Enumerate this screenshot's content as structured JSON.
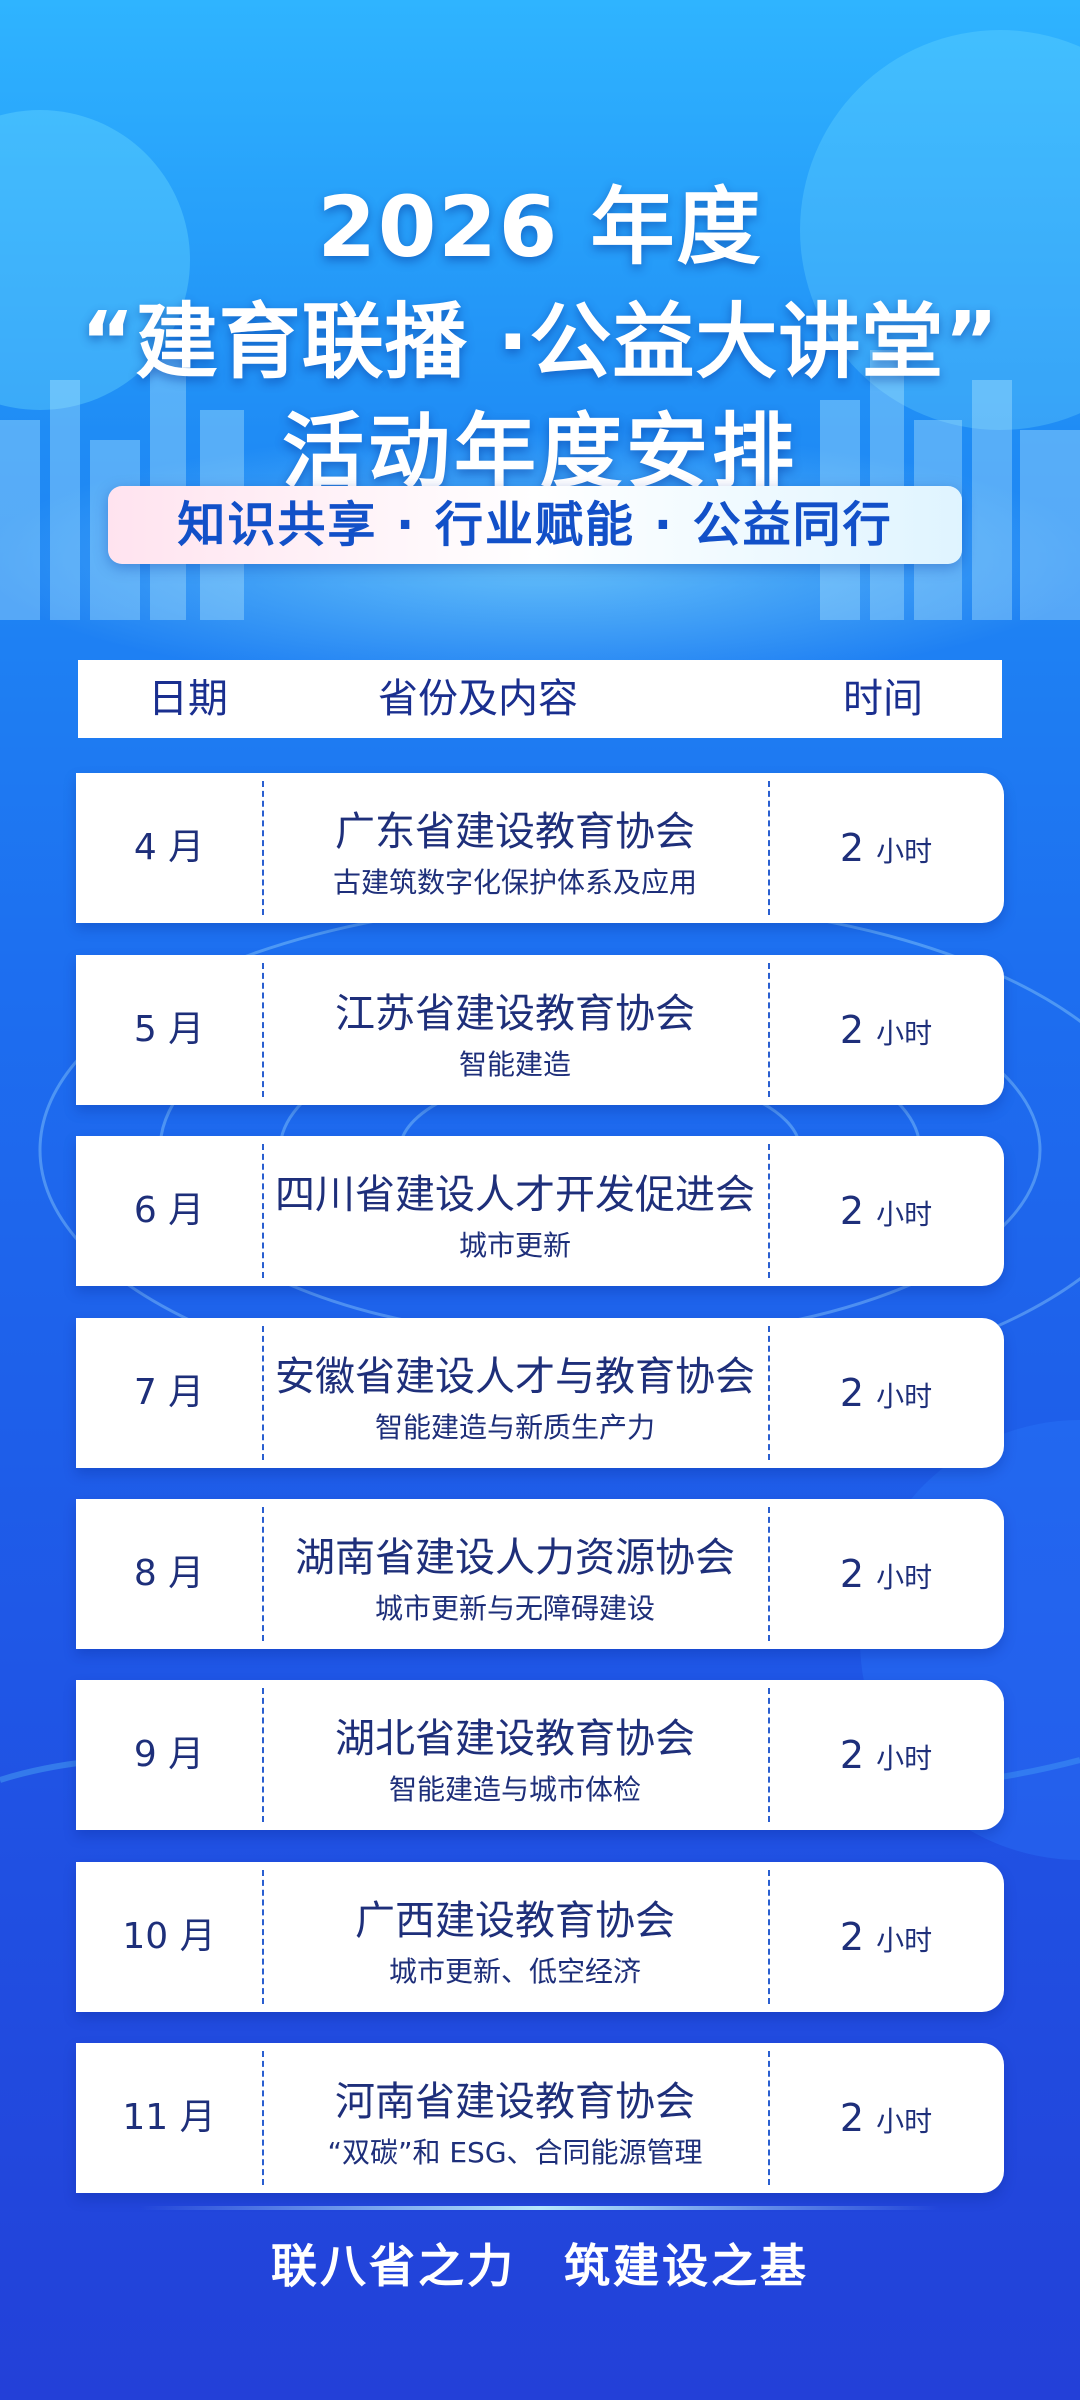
{
  "title": {
    "line1": "2026 年度",
    "line2": "“建育联播 ·公益大讲堂”",
    "line3": "活动年度安排"
  },
  "slogan": "知识共享 · 行业赋能 · 公益同行",
  "table": {
    "headers": {
      "date": "日期",
      "content": "省份及内容",
      "time": "时间"
    },
    "rows": [
      {
        "month": "4 月",
        "org": "广东省建设教育协会",
        "topic": "古建筑数字化保护体系及应用",
        "hours": "2",
        "unit": "小时"
      },
      {
        "month": "5 月",
        "org": "江苏省建设教育协会",
        "topic": "智能建造",
        "hours": "2",
        "unit": "小时"
      },
      {
        "month": "6 月",
        "org": "四川省建设人才开发促进会",
        "topic": "城市更新",
        "hours": "2",
        "unit": "小时"
      },
      {
        "month": "7 月",
        "org": "安徽省建设人才与教育协会",
        "topic": "智能建造与新质生产力",
        "hours": "2",
        "unit": "小时"
      },
      {
        "month": "8 月",
        "org": "湖南省建设人力资源协会",
        "topic": "城市更新与无障碍建设",
        "hours": "2",
        "unit": "小时"
      },
      {
        "month": "9 月",
        "org": "湖北省建设教育协会",
        "topic": "智能建造与城市体检",
        "hours": "2",
        "unit": "小时"
      },
      {
        "month": "10 月",
        "org": "广西建设教育协会",
        "topic": "城市更新、低空经济",
        "hours": "2",
        "unit": "小时"
      },
      {
        "month": "11 月",
        "org": "河南省建设教育协会",
        "topic": "“双碳”和 ESG、合同能源管理",
        "hours": "2",
        "unit": "小时"
      }
    ]
  },
  "footer": {
    "left": "联八省之力",
    "right": "筑建设之基"
  },
  "colors": {
    "accent": "#1250c8",
    "text": "#1e2f7a",
    "bg_top": "#2fb4ff",
    "bg_bottom": "#2340d8"
  }
}
